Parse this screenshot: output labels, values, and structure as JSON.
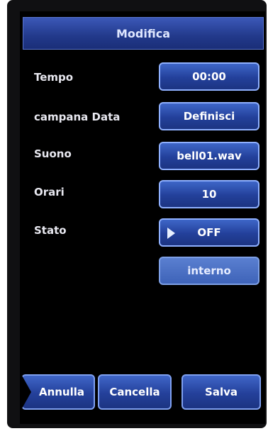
{
  "title": "Modifica",
  "rows": [
    {
      "label": "Tempo",
      "value": "00:00"
    },
    {
      "label": "campana Data",
      "value": "Definisci"
    },
    {
      "label": "Suono",
      "value": "bell01.wav"
    },
    {
      "label": "Orari",
      "value": "10"
    },
    {
      "label": "Stato",
      "value": "OFF"
    }
  ],
  "extra_button": "interno",
  "bottom": {
    "back": "Annulla",
    "delete": "Cancella",
    "save": "Salva"
  },
  "icons": {
    "state_toggle": "play-arrow-icon",
    "back": "back-arrow-shape"
  },
  "colors": {
    "button": "#23409a",
    "button_border": "#8fb0ff",
    "background": "#000000"
  }
}
